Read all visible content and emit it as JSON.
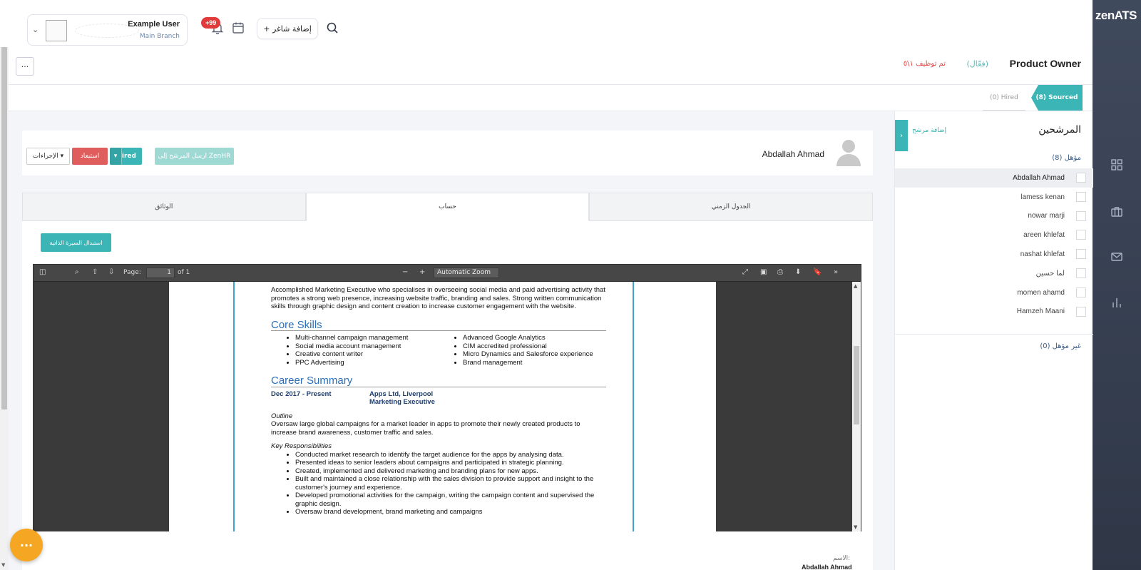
{
  "brand": {
    "logo_text": "zenATS"
  },
  "nav": {
    "icons": [
      "grid-icon",
      "briefcase-icon",
      "mail-icon",
      "bar-chart-icon"
    ]
  },
  "topbar": {
    "user_name": "Example User",
    "user_branch": "Main Branch",
    "notification_badge": "+99",
    "add_job_label": "+ إضافة شاغر"
  },
  "job": {
    "more_label": "···",
    "title": "Product Owner",
    "status": "(فعّال)",
    "hired_text": "تم توظيف ١\\٥"
  },
  "stages": {
    "sourced": "(8) Sourced",
    "hired": "(0) Hired"
  },
  "candidates": {
    "title": "المرشحين",
    "add_label": "إضافة مرشح",
    "qualified_label": "مؤهل (8)",
    "unqualified_label": "غير مؤهل (0)",
    "list": [
      "Abdallah Ahmad",
      "lamess kenan",
      "nowar marji",
      "areen khlefat",
      "nashat khlefat",
      "لما حسين",
      "momen ahamd",
      "Hamzeh Maani"
    ]
  },
  "candidate_card": {
    "name": "Abdallah Ahmad",
    "actions_label": "الإجراءات ▾",
    "withdraw_label": "استبعاد",
    "hired_label": "Hired",
    "hired_caret": "▾",
    "zenhr_label": "ارسل المرشح إلى ZenHR"
  },
  "profile_tabs": {
    "timeline": "الجدول الزمني",
    "account": "حساب",
    "documents": "الوثائق"
  },
  "cv": {
    "replace_label": "استبدال السيرة الذاتية"
  },
  "pdf_viewer": {
    "page_label": "Page:",
    "page_value": "1",
    "of_label": "of 1",
    "zoom_label": "Automatic Zoom",
    "intro": "Accomplished Marketing Executive who specialises in overseeing social media and paid advertising activity that promotes a strong web presence, increasing website traffic, branding and sales. Strong written communication skills through graphic design and content creation to increase customer engagement with the website.",
    "core_skills_heading": "Core Skills",
    "skills_left": [
      "Multi-channel campaign management",
      "Social media account management",
      "Creative content writer",
      "PPC Advertising"
    ],
    "skills_right": [
      "Advanced Google Analytics",
      "CIM accredited professional",
      "Micro Dynamics and Salesforce experience",
      "Brand management"
    ],
    "career_heading": "Career Summary",
    "career_dates": "Dec 2017 - Present",
    "career_company": "Apps Ltd, Liverpool",
    "career_role": "Marketing Executive",
    "outline_label": "Outline",
    "outline_text": "Oversaw large global campaigns for a market leader in apps to promote their newly created products to increase brand awareness, customer traffic and sales.",
    "resp_label": "Key Responsibilities",
    "responsibilities": [
      "Conducted market research to identify the target audience for the apps by analysing data.",
      "Presented ideas to senior leaders about campaigns and participated in strategic planning.",
      "Created, implemented and delivered marketing and branding plans for new apps.",
      "Built and maintained a close relationship with the sales division to provide support and insight to the customer's journey and experience.",
      "Developed promotional activities for the campaign, writing the campaign content and supervised the graphic design.",
      "Oversaw brand development, brand marketing and campaigns"
    ]
  },
  "profile_fields": {
    "name_label": "الاسم:",
    "name_value": "Abdallah Ahmad"
  },
  "fab": {
    "label": "···"
  },
  "colors": {
    "accent": "#3bb5b5",
    "danger": "#e05d5d",
    "fab": "#f5a623",
    "rail": "#343c4d"
  }
}
